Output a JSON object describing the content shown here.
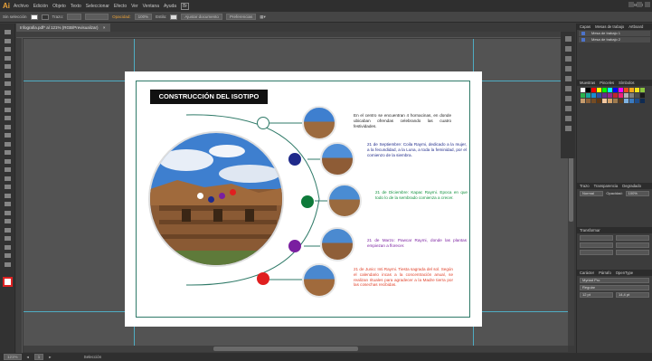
{
  "app": {
    "logo": "Ai",
    "menus": [
      "Archivo",
      "Edición",
      "Objeto",
      "Texto",
      "Seleccionar",
      "Efecto",
      "Ver",
      "Ventana",
      "Ayuda"
    ],
    "bridge_icon": "Br",
    "workspace": "Diseño",
    "controlbar": {
      "selection_label": "Sin selección",
      "stroke_label": "Trazo:",
      "opacity_label": "Opacidad:",
      "opacity_value": "100%",
      "style_label": "Estilo:",
      "doc_setup_button": "Ajustar documento",
      "prefs_button": "Preferencias"
    },
    "document_tab": "Infografia.pdf* al 121% (RGB/Previsualizar)",
    "status": {
      "zoom": "121%",
      "page": "1",
      "mode": "Selección"
    }
  },
  "document": {
    "title": "CONSTRUCCIÓN DEL ISOTIPO",
    "items": [
      {
        "color": "#ffffff",
        "text_color": "#222222",
        "text": "En el centro se encuentran 4 hornacinas, en donde ubicaban ofrendas celebrando las cuatro festividades."
      },
      {
        "color": "#1f2a8a",
        "text_color": "#1f2a8a",
        "text": "21 de Septiembre: Coila Raymi, dedicado a la mujer, a la fecundidad, a la Luna, a toda la feminidad, por el comienzo de la siembra."
      },
      {
        "color": "#0e7a3a",
        "text_color": "#12923e",
        "text": "21 de Diciembre: Kapac Raymi. Epoca en que todo lo de la sembrado comienza a crecer."
      },
      {
        "color": "#7a1fa0",
        "text_color": "#7a1fa0",
        "text": "21 de Marzo: Pawcar Raymi, donde las plantas empiezan a florecer."
      },
      {
        "color": "#e01f1f",
        "text_color": "#e0412a",
        "text": "21 de Junio: Inti Raymi. Tiesta sagrada del sol. Según el calendario incas a la concentración anual, se realizan rituales para agradecer a la Madre tierra por las cosechas recibidas."
      }
    ]
  },
  "panels": {
    "layers_tabs": [
      "Capas",
      "Mesas de trabajo",
      "Artboard"
    ],
    "layers": [
      "Mesa de trabajo 1",
      "Mesa de trabajo 2"
    ],
    "swatches_tabs": [
      "Muestras",
      "Pinceles",
      "Símbolos"
    ],
    "transparency_tabs": [
      "Trazo",
      "Transparencia",
      "Degradado"
    ],
    "blend_mode": "Normal",
    "opacity_label": "Opacidad:",
    "opacity_value": "100%",
    "transform_tab": "Transformar",
    "character_tabs": [
      "Carácter",
      "Párrafo",
      "OpenType"
    ],
    "font_family": "Myriad Pro",
    "font_style": "Regular",
    "font_size": "12 pt",
    "leading": "14,4 pt"
  }
}
